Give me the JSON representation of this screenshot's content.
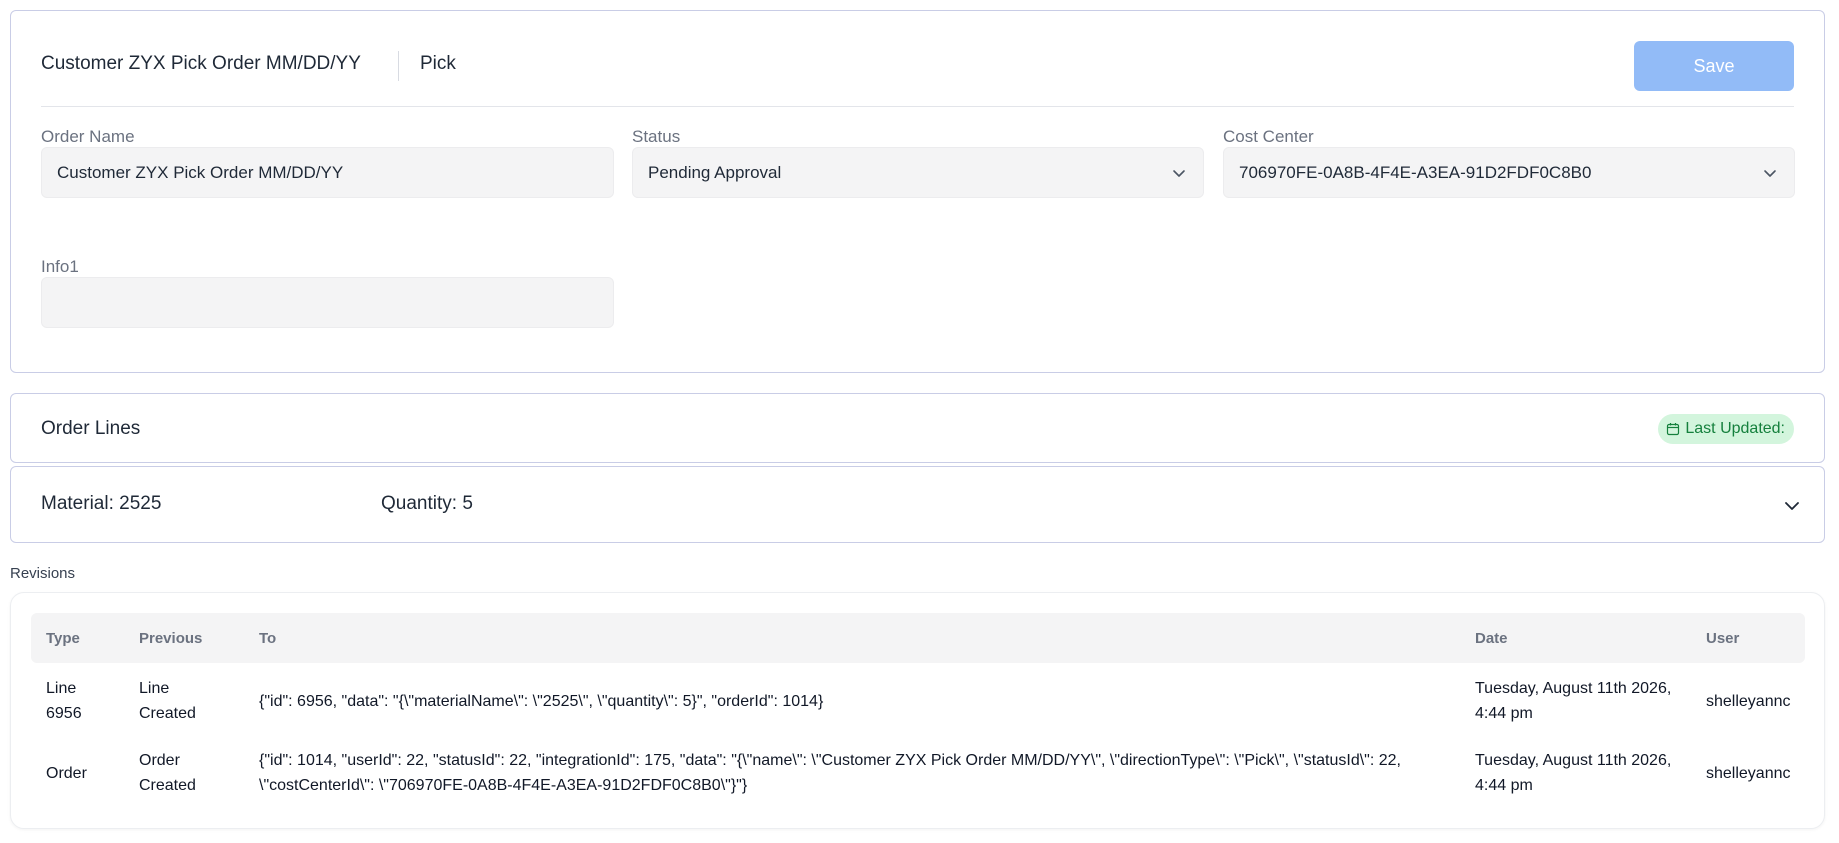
{
  "header": {
    "order_title": "Customer ZYX Pick Order MM/DD/YY",
    "direction": "Pick",
    "save_label": "Save"
  },
  "fields": {
    "order_name": {
      "label": "Order Name",
      "value": "Customer ZYX Pick Order MM/DD/YY"
    },
    "status": {
      "label": "Status",
      "value": "Pending Approval"
    },
    "cost_center": {
      "label": "Cost Center",
      "value": "706970FE-0A8B-4F4E-A3EA-91D2FDF0C8B0"
    },
    "info1": {
      "label": "Info1",
      "value": ""
    }
  },
  "order_lines": {
    "title": "Order Lines",
    "last_updated": "Last Updated:",
    "items": [
      {
        "material": "Material: 2525",
        "quantity": "Quantity: 5"
      }
    ]
  },
  "revisions": {
    "label": "Revisions",
    "columns": [
      "Type",
      "Previous",
      "To",
      "Date",
      "User"
    ],
    "rows": [
      {
        "type": "Line 6956",
        "previous": "Line Created",
        "to": "{\"id\": 6956, \"data\": \"{\\\"materialName\\\": \\\"2525\\\", \\\"quantity\\\": 5}\", \"orderId\": 1014}",
        "date": "Tuesday, August 11th 2026, 4:44 pm",
        "user": "shelleyannc"
      },
      {
        "type": "Order",
        "previous": "Order Created",
        "to": "{\"id\": 1014, \"userId\": 22, \"statusId\": 22, \"integrationId\": 175, \"data\": \"{\\\"name\\\": \\\"Customer ZYX Pick Order MM/DD/YY\\\", \\\"directionType\\\": \\\"Pick\\\", \\\"statusId\\\": 22, \\\"costCenterId\\\": \\\"706970FE-0A8B-4F4E-A3EA-91D2FDF0C8B0\\\"}\"}",
        "date": "Tuesday, August 11th 2026, 4:44 pm",
        "user": "shelleyannc"
      }
    ]
  },
  "colors": {
    "accent": "#92bbf7",
    "border": "#c9cde6",
    "badge_bg": "#d3f5dd",
    "badge_text": "#15803d"
  },
  "icons": {
    "status_dropdown": "chevron-down-icon",
    "cost_center_dropdown": "chevron-down-icon",
    "last_updated": "calendar-icon",
    "expand_line": "chevron-down-icon"
  }
}
